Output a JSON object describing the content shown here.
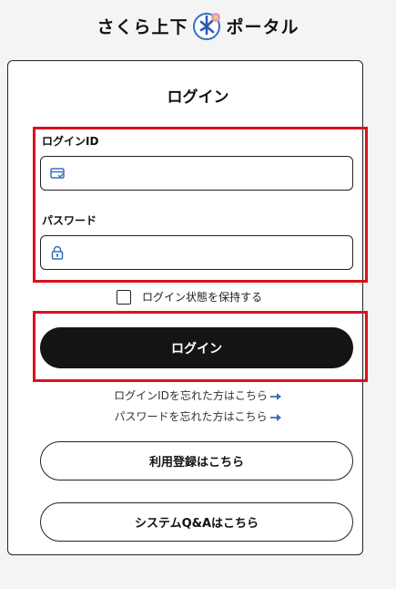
{
  "header": {
    "logo_left": "さくら上下",
    "logo_right": "ポータル"
  },
  "login": {
    "title": "ログイン",
    "id_label": "ログインID",
    "id_value": "",
    "password_label": "パスワード",
    "password_value": "",
    "remember_label": "ログイン状態を保持する",
    "submit_label": "ログイン"
  },
  "links": {
    "forgot_id": "ログインIDを忘れた方はこちら",
    "forgot_password": "パスワードを忘れた方はこちら"
  },
  "buttons": {
    "register": "利用登録はこちら",
    "faq": "システムQ&Aはこちら"
  },
  "colors": {
    "highlight": "#d9121b",
    "accent": "#3a6ebf",
    "button": "#141414"
  },
  "icons": {
    "logo": "water-drop-logo-icon",
    "id_field": "id-card-icon",
    "password_field": "lock-icon",
    "link_arrow": "arrow-right-icon"
  }
}
